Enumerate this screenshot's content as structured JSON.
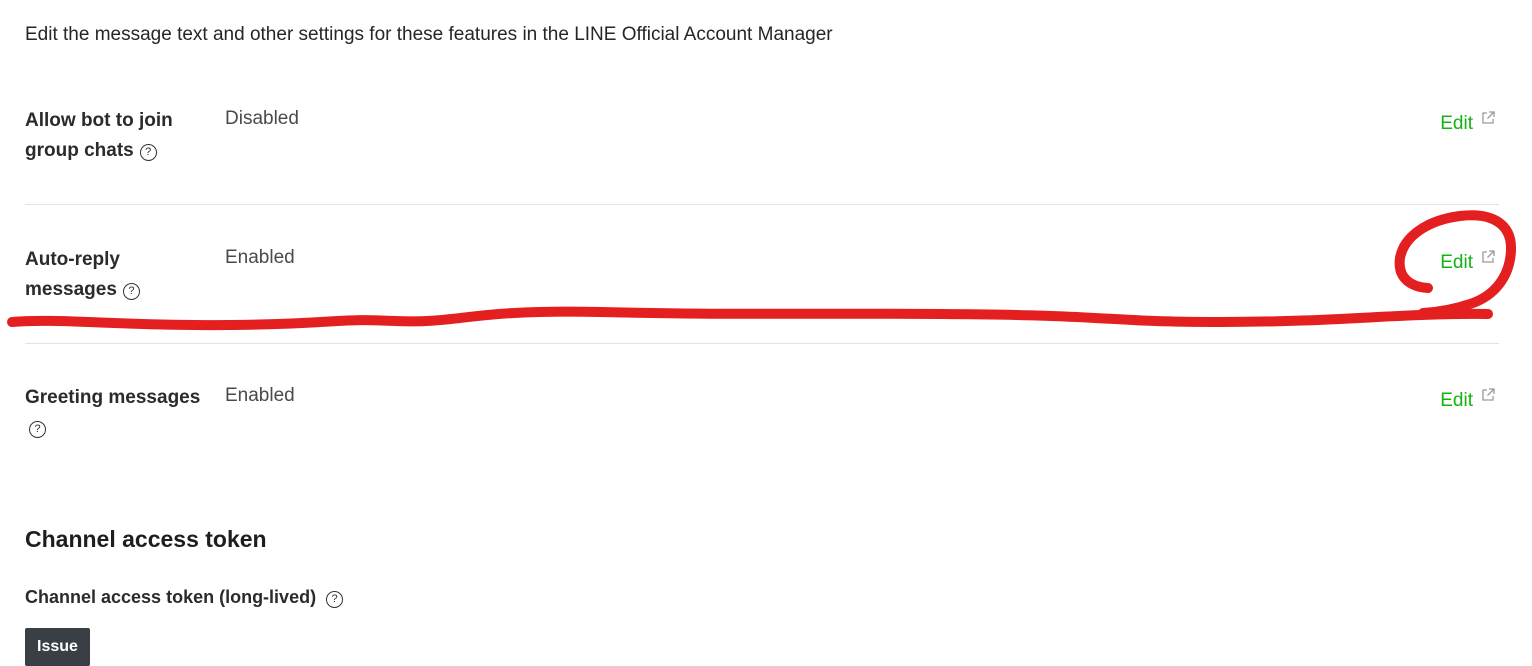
{
  "intro_text": "Edit the message text and other settings for these features in the LINE Official Account Manager",
  "settings": [
    {
      "label_line1": "Allow bot to join",
      "label_line2": "group chats",
      "value": "Disabled",
      "edit_label": "Edit"
    },
    {
      "label_line1": "Auto-reply",
      "label_line2": "messages",
      "value": "Enabled",
      "edit_label": "Edit"
    },
    {
      "label_line1": "Greeting messages",
      "label_line2": "",
      "value": "Enabled",
      "edit_label": "Edit"
    }
  ],
  "help_glyph": "?",
  "channel_access_token": {
    "title": "Channel access token",
    "sub_label": "Channel access token (long-lived)",
    "issue_button": "Issue"
  },
  "colors": {
    "edit_link": "#12b312",
    "issue_button_bg": "#3a3f45",
    "annotation_red": "#e41f1f"
  },
  "icons": {
    "help": "question-circle-icon",
    "external": "external-link-icon"
  }
}
